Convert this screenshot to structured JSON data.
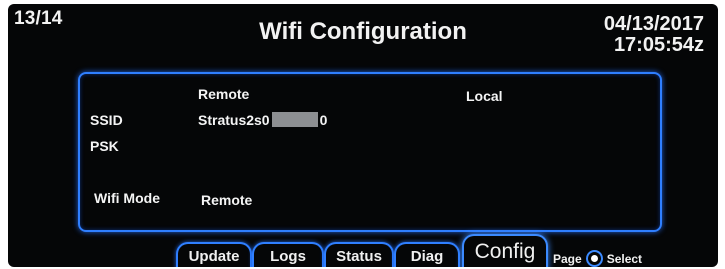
{
  "header": {
    "page_counter": "13/14",
    "title": "Wifi Configuration",
    "date": "04/13/2017",
    "time": "17:05:54z"
  },
  "panel": {
    "remote_header": "Remote",
    "local_header": "Local",
    "ssid_label": "SSID",
    "ssid_prefix": "Stratus2s0",
    "ssid_suffix": "0",
    "psk_label": "PSK",
    "wifi_mode_label": "Wifi Mode",
    "wifi_mode_value": "Remote"
  },
  "tabs": [
    {
      "label": "Update"
    },
    {
      "label": "Logs"
    },
    {
      "label": "Status"
    },
    {
      "label": "Diag"
    },
    {
      "label": "Config",
      "active": true
    }
  ],
  "footer": {
    "page_label": "Page",
    "select_label": "Select",
    "select_icon": "knob-icon"
  },
  "colors": {
    "screen_bg": "#050607",
    "accent_border": "#2f7fff",
    "text": "#f2f2f2",
    "redaction": "#8d8f92"
  }
}
